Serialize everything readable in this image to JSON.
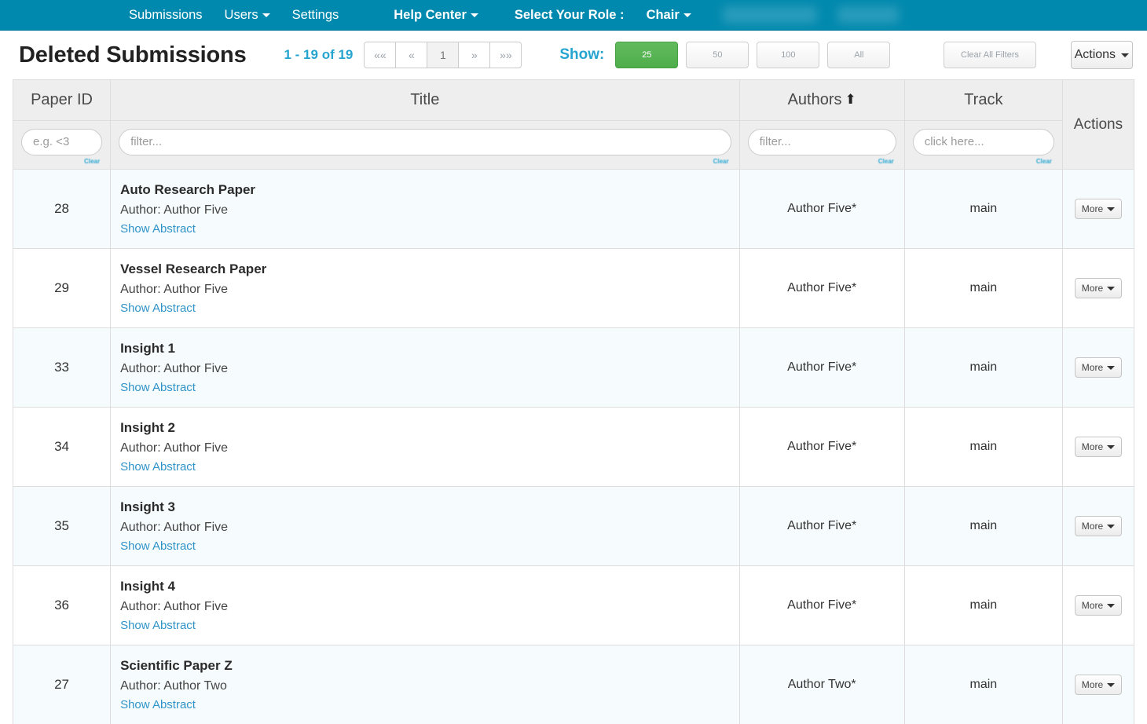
{
  "navbar": {
    "items": [
      {
        "label": "Submissions",
        "caret": false,
        "bold": false
      },
      {
        "label": "Users",
        "caret": true,
        "bold": false
      },
      {
        "label": "Settings",
        "caret": false,
        "bold": false
      },
      {
        "label": "Help Center",
        "caret": true,
        "bold": true
      },
      {
        "label": "Select Your Role :",
        "caret": false,
        "bold": true
      },
      {
        "label": "Chair",
        "caret": true,
        "bold": true
      }
    ],
    "background_color": "#0089ae"
  },
  "header": {
    "title": "Deleted Submissions",
    "range_label": "1 - 19 of 19",
    "pagination": [
      {
        "label": "««",
        "name": "first-page",
        "active": false
      },
      {
        "label": "«",
        "name": "prev-page",
        "active": false
      },
      {
        "label": "1",
        "name": "page-1",
        "active": true
      },
      {
        "label": "»",
        "name": "next-page",
        "active": false
      },
      {
        "label": "»»",
        "name": "last-page",
        "active": false
      }
    ],
    "show_label": "Show:",
    "show_options": [
      {
        "label": "25",
        "selected": true
      },
      {
        "label": "50",
        "selected": false
      },
      {
        "label": "100",
        "selected": false
      },
      {
        "label": "All",
        "selected": false
      }
    ],
    "clear_all_filters": "Clear All Filters",
    "actions_button": "Actions",
    "accent_color": "#25a4cf",
    "selected_color": "#4ead4a"
  },
  "table": {
    "columns": {
      "paper_id": "Paper ID",
      "title": "Title",
      "authors": "Authors",
      "authors_sort": "⬆",
      "track": "Track",
      "actions": "Actions"
    },
    "filters": {
      "paper_id_placeholder": "e.g. <3",
      "title_placeholder": "filter...",
      "authors_placeholder": "filter...",
      "track_placeholder": "click here...",
      "clear_label": "Clear"
    },
    "row_labels": {
      "author_prefix": "Author: ",
      "show_abstract": "Show Abstract",
      "more": "More"
    },
    "rows": [
      {
        "paper_id": "28",
        "title": "Auto Research Paper",
        "author": "Author Five",
        "authors": "Author Five*",
        "track": "main"
      },
      {
        "paper_id": "29",
        "title": "Vessel Research Paper",
        "author": "Author Five",
        "authors": "Author Five*",
        "track": "main"
      },
      {
        "paper_id": "33",
        "title": "Insight 1",
        "author": "Author Five",
        "authors": "Author Five*",
        "track": "main"
      },
      {
        "paper_id": "34",
        "title": "Insight 2",
        "author": "Author Five",
        "authors": "Author Five*",
        "track": "main"
      },
      {
        "paper_id": "35",
        "title": "Insight 3",
        "author": "Author Five",
        "authors": "Author Five*",
        "track": "main"
      },
      {
        "paper_id": "36",
        "title": "Insight 4",
        "author": "Author Five",
        "authors": "Author Five*",
        "track": "main"
      },
      {
        "paper_id": "27",
        "title": "Scientific Paper Z",
        "author": "Author Two",
        "authors": "Author Two*",
        "track": "main"
      }
    ]
  }
}
